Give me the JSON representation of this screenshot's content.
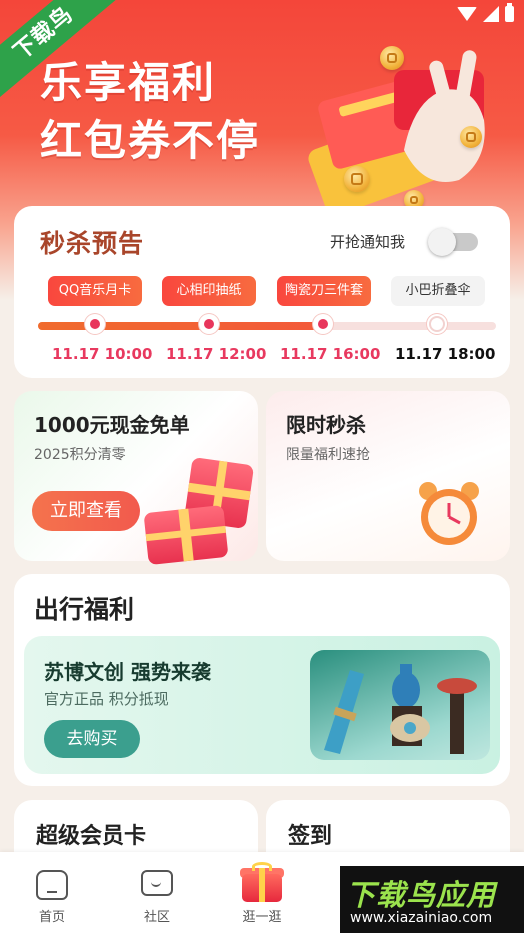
{
  "watermark_ribbon": "下载鸟",
  "hero": {
    "line1": "乐享福利",
    "line2": "红包券不停"
  },
  "flash_sale": {
    "title": "秒杀预告",
    "notify_label": "开抢通知我",
    "notify_enabled": false,
    "sessions": [
      {
        "label": "QQ音乐月卡",
        "time": "11.17 10:00",
        "active": true
      },
      {
        "label": "心相印抽纸",
        "time": "11.17 12:00",
        "active": true
      },
      {
        "label": "陶瓷刀三件套",
        "time": "11.17 16:00",
        "active": true
      },
      {
        "label": "小巴折叠伞",
        "time": "11.17 18:00",
        "active": false
      }
    ]
  },
  "promo_free": {
    "title": "1000元现金免单",
    "subtitle": "2025积分清零",
    "button": "立即查看"
  },
  "promo_flash": {
    "title": "限时秒杀",
    "subtitle": "限量福利速抢"
  },
  "travel": {
    "section_title": "出行福利",
    "banner_title": "苏博文创 强势来袭",
    "banner_subtitle": "官方正品 积分抵现",
    "banner_button": "去购买"
  },
  "vip_card": {
    "title": "超级会员卡"
  },
  "sign_in": {
    "title": "签到"
  },
  "tabbar": {
    "items": [
      {
        "label": "首页",
        "icon": "home-icon"
      },
      {
        "label": "社区",
        "icon": "chat-icon"
      },
      {
        "label": "逛一逛",
        "icon": "gift-icon"
      }
    ]
  },
  "watermark": {
    "title": "下载鸟应用",
    "url": "www.xiazainiao.com"
  },
  "colors": {
    "hero_red": "#f4463a",
    "accent_pink": "#e8395f",
    "flash_title": "#a9452a",
    "travel_button": "#3b9f8e"
  }
}
